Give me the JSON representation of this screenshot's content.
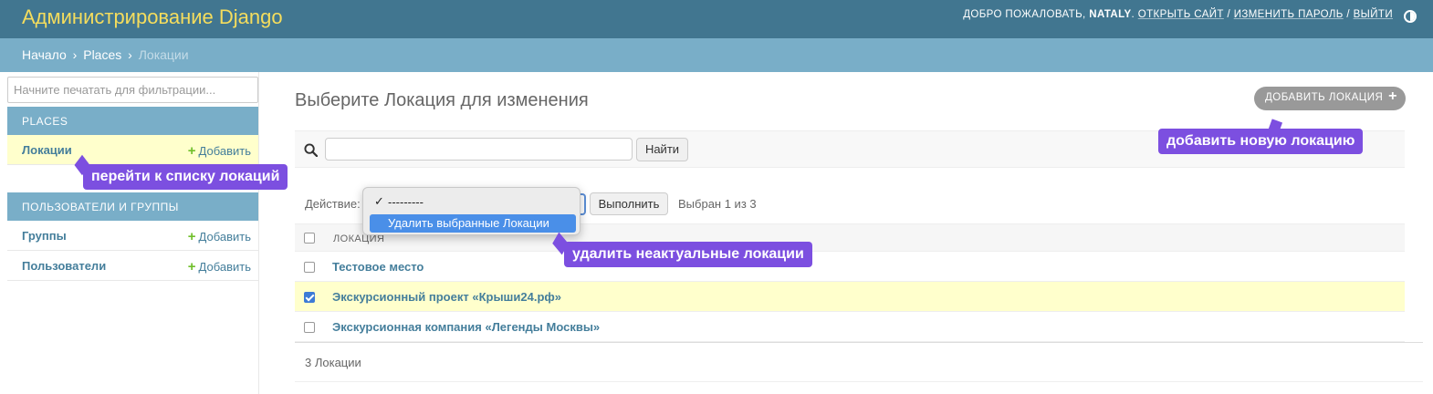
{
  "header": {
    "brand": "Администрирование Django",
    "welcome": "Добро пожаловать,",
    "username": "NATALY",
    "view_site": "Открыть сайт",
    "change_password": "Изменить пароль",
    "logout": "Выйти",
    "sep": "/"
  },
  "breadcrumbs": {
    "home": "Начало",
    "app": "Places",
    "current": "Локации",
    "sep": "›"
  },
  "sidebar": {
    "filter_placeholder": "Начните печатать для фильтрации...",
    "modules": [
      {
        "caption": "Places",
        "items": [
          {
            "name": "Локации",
            "add": "Добавить"
          }
        ]
      },
      {
        "caption": "Пользователи и группы",
        "items": [
          {
            "name": "Группы",
            "add": "Добавить"
          },
          {
            "name": "Пользователи",
            "add": "Добавить"
          }
        ]
      }
    ]
  },
  "main": {
    "title": "Выберите Локация для изменения",
    "add_button": "Добавить Локация",
    "search_button": "Найти",
    "actions_label": "Действие:",
    "action_options": [
      "---------",
      "Удалить выбранные Локации"
    ],
    "run_button": "Выполнить",
    "selection_count": "Выбран 1 из 3",
    "column_header": "Локация",
    "rows": [
      {
        "name": "Тестовое место",
        "checked": false
      },
      {
        "name": "Экскурсионный проект «Крыши24.рф»",
        "checked": true
      },
      {
        "name": "Экскурсионная компания «Легенды Москвы»",
        "checked": false
      }
    ],
    "paginator": "3 Локации"
  },
  "annotations": {
    "list": "перейти к списку локаций",
    "add": "добавить новую локацию",
    "delete": "удалить неактуальные локации",
    "color": "#7c4fe0"
  },
  "colors": {
    "header": "#417690",
    "breadcrumbs": "#79aec8",
    "brand": "#f5dd5d",
    "link": "#447e9b",
    "selected_row": "#ffffcc"
  }
}
